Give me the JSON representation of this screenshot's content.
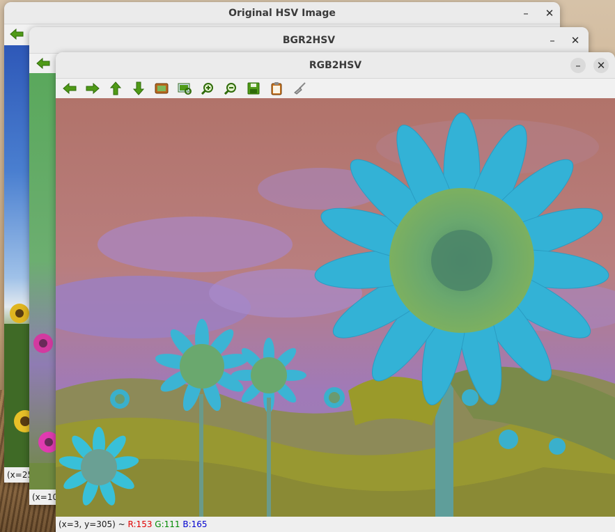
{
  "windows": [
    {
      "title": "Original HSV Image",
      "minimize_label": "–",
      "close_label": "✕",
      "status_text": "(x=25"
    },
    {
      "title": "BGR2HSV",
      "minimize_label": "–",
      "close_label": "✕",
      "status_text": "(x=10"
    },
    {
      "title": "RGB2HSV",
      "minimize_label": "–",
      "close_label": "✕",
      "status": {
        "coords": "(x=3, y=305) ~",
        "r": "R:153",
        "g": "G:111",
        "b": "B:165"
      }
    }
  ],
  "toolbar_icons": [
    "arrow-left-icon",
    "arrow-right-icon",
    "arrow-up-icon",
    "arrow-down-icon",
    "zoom-fit-icon",
    "zoom-image-icon",
    "zoom-in-icon",
    "zoom-out-icon",
    "save-icon",
    "properties-icon",
    "clear-icon"
  ],
  "colors": {
    "toolbar_green": "#4f9a17",
    "sky_hsv": "#b57a72",
    "petal_cyan": "#33b8d8",
    "foliage_olive": "#9a9a2a",
    "cloud_violet": "#9a7fb9"
  }
}
